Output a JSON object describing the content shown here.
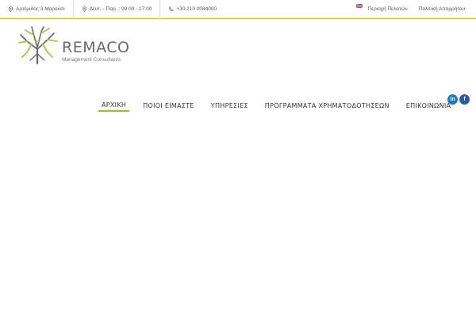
{
  "topbar": {
    "address": "Αρτέμιδος 3 Μαρούσι",
    "hours": "Δευτ. - Παρ. : 09:00 - 17:00",
    "phone": "+30 210 0084000",
    "client_area": "Περιοχή Πελατών",
    "privacy": "Πολιτική Απορρήτου"
  },
  "logo": {
    "brand": "REMACO",
    "tagline": "Management Consultants"
  },
  "nav": {
    "items": [
      "ΑΡΧΙΚΗ",
      "ΠΟΙΟΙ ΕΙΜΑΣΤΕ",
      "ΥΠΗΡΕΣΙΕΣ",
      "ΠΡΟΓΡΑΜΜΑΤΑ ΧΡΗΜΑΤΟΔΟΤΗΣΕΩΝ",
      "ΕΠΙΚΟΙΝΩΝΙΑ"
    ],
    "active": 0
  },
  "social": {
    "linkedin": "in",
    "facebook": "f"
  },
  "colors": {
    "accent": "#8cc43f",
    "topbar_border": "#a6c64a",
    "social_blue": "#2a5aa6"
  }
}
